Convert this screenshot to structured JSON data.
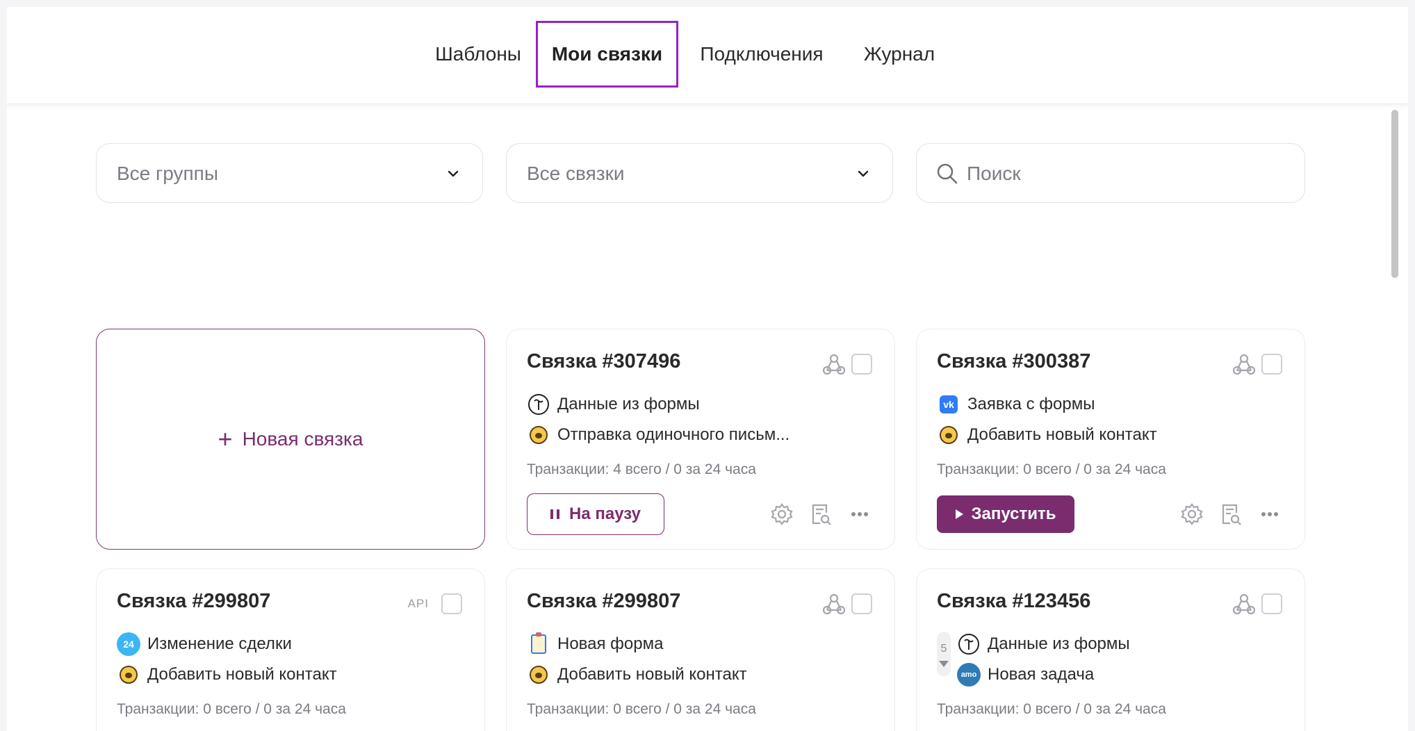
{
  "tabs": [
    {
      "label": "Шаблоны",
      "active": false
    },
    {
      "label": "Мои связки",
      "active": true
    },
    {
      "label": "Подключения",
      "active": false
    },
    {
      "label": "Журнал",
      "active": false
    }
  ],
  "filters": {
    "groups": "Все группы",
    "links": "Все связки",
    "search_placeholder": "Поиск"
  },
  "new_card": {
    "label": "Новая связка"
  },
  "cards": [
    {
      "title": "Связка #307496",
      "badge": "webhook-icon",
      "steps": [
        {
          "icon": "tilda-icon",
          "text": "Данные из формы"
        },
        {
          "icon": "mailchimp-icon",
          "text": "Отправка одиночного письм..."
        }
      ],
      "transactions": "Транзакции: 4 всего / 0 за 24 часа",
      "action": "На паузу"
    },
    {
      "title": "Связка #300387",
      "badge": "webhook-icon",
      "steps": [
        {
          "icon": "vk-icon",
          "text": "Заявка с формы"
        },
        {
          "icon": "mailchimp-icon",
          "text": "Добавить новый контакт"
        }
      ],
      "transactions": "Транзакции: 0 всего / 0 за 24 часа",
      "action": "Запустить"
    },
    {
      "title": "Связка #299807",
      "badge": "API",
      "steps": [
        {
          "icon": "bitrix24-icon",
          "label": "24",
          "text": "Изменение сделки"
        },
        {
          "icon": "mailchimp-icon",
          "text": "Добавить новый контакт"
        }
      ],
      "transactions": "Транзакции: 0 всего / 0 за 24 часа"
    },
    {
      "title": "Связка #299807",
      "badge": "webhook-icon",
      "steps": [
        {
          "icon": "clipboard-icon",
          "text": "Новая форма"
        },
        {
          "icon": "mailchimp-icon",
          "text": "Добавить новый контакт"
        }
      ],
      "transactions": "Транзакции: 0 всего / 0 за 24 часа"
    },
    {
      "title": "Связка #123456",
      "badge": "webhook-icon",
      "counter": "5",
      "steps": [
        {
          "icon": "tilda-icon",
          "text": "Данные из формы"
        },
        {
          "icon": "amocrm-icon",
          "label": "amo",
          "text": "Новая задача"
        }
      ],
      "transactions": "Транзакции: 0 всего / 0 за 24 часа"
    }
  ],
  "colors": {
    "accent": "#7a2c6e",
    "active_tab_border": "#9a1fc2",
    "muted_text": "#7b7b84",
    "bitrix_blue": "#3bb6f5",
    "amo_blue": "#2f7bb5",
    "vk_blue": "#2f7cf6"
  }
}
